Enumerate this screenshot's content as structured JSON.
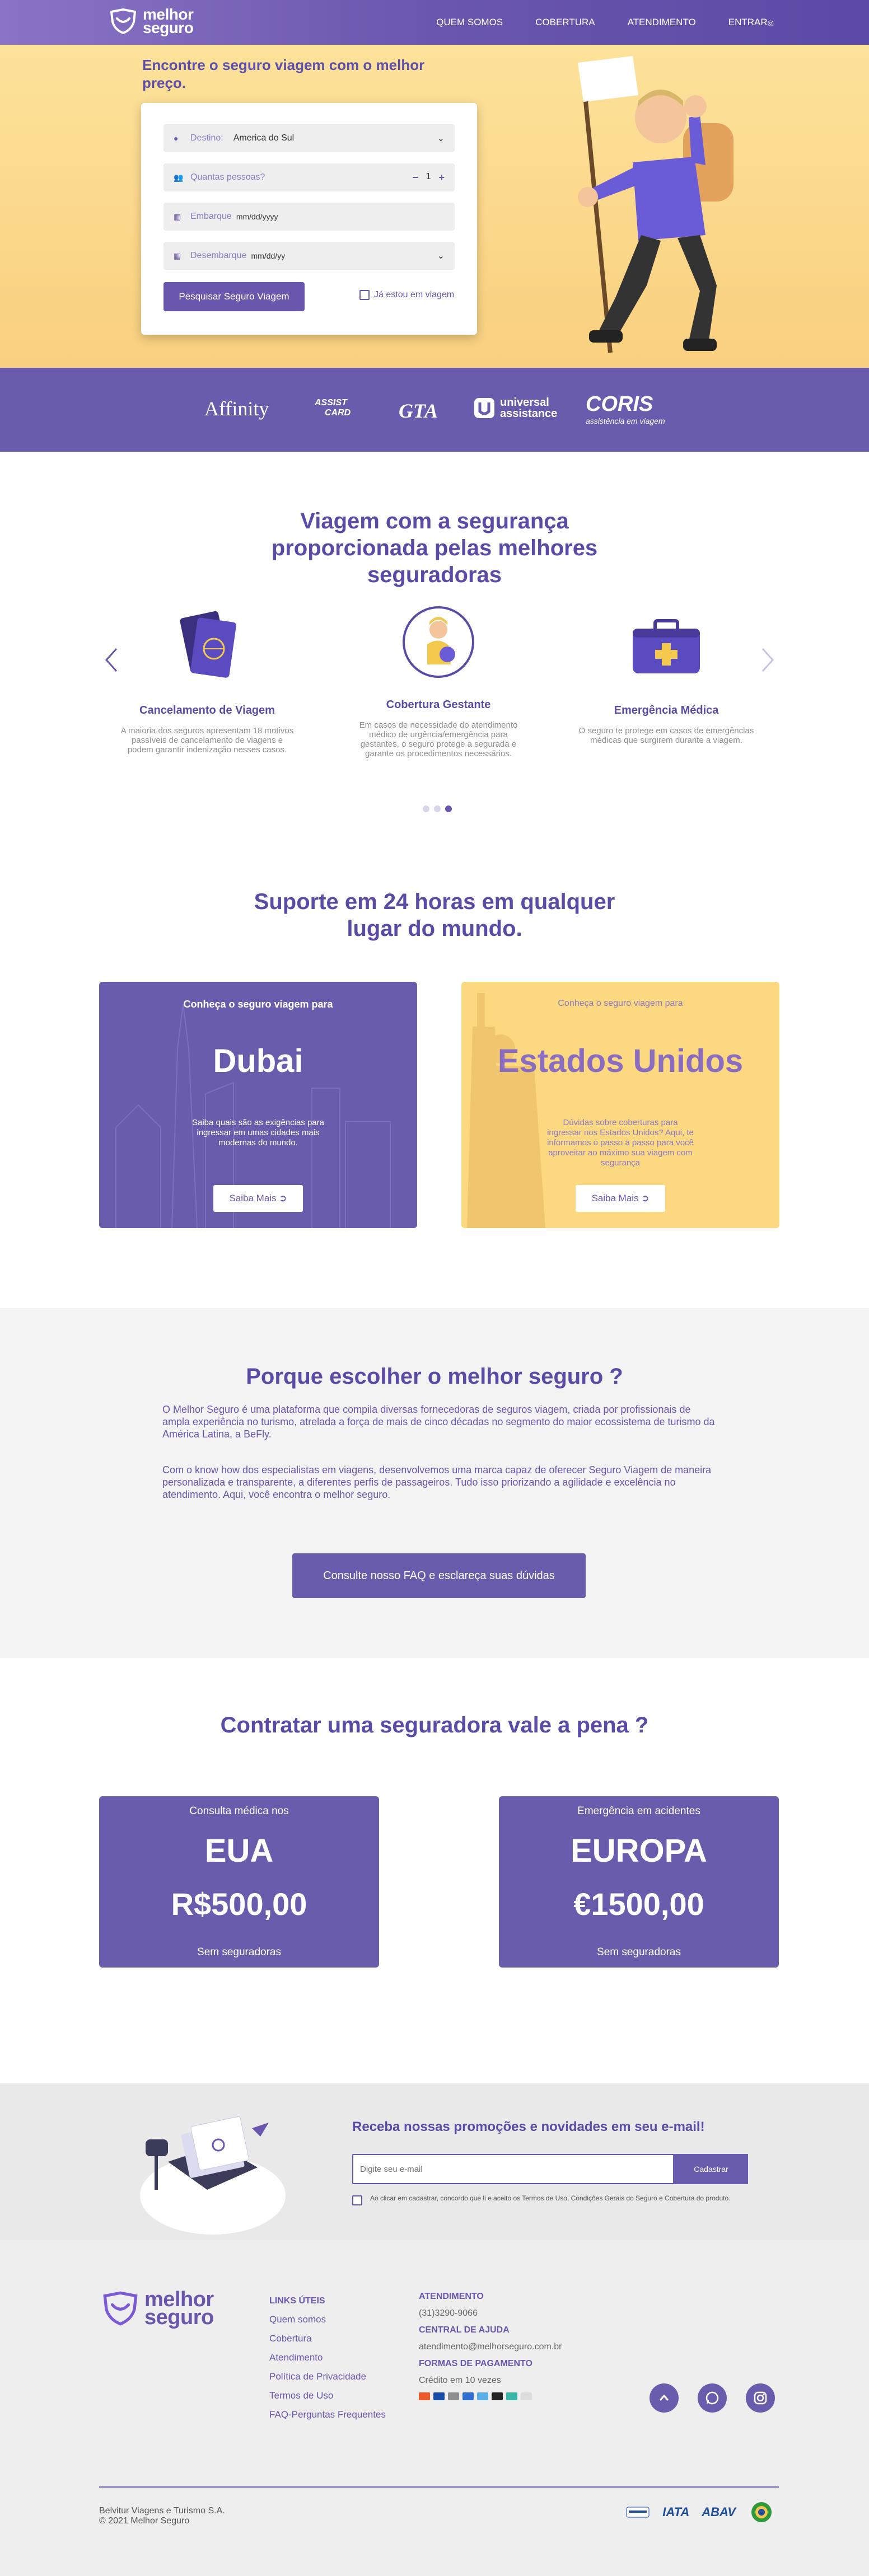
{
  "header": {
    "logo_line1": "melhor",
    "logo_line2": "seguro",
    "nav": [
      "QUEM SOMOS",
      "COBERTURA",
      "ATENDIMENTO",
      "ENTRAR"
    ]
  },
  "hero": {
    "title": "Encontre o seguro viagem com o melhor preço.",
    "destino_label": "Destino:",
    "destino_value": "America do Sul",
    "pessoas_label": "Quantas pessoas?",
    "pessoas_value": "1",
    "embarque_label": "Embarque",
    "embarque_placeholder": "mm/dd/yyyy",
    "desembarque_label": "Desembarque",
    "desembarque_placeholder": "mm/dd/yy",
    "search_button": "Pesquisar Seguro Viagem",
    "already_traveling": "Já estou em viagem"
  },
  "partners": {
    "affinity": "Affinity",
    "assist_card_1": "ASSIST",
    "assist_card_2": "CARD",
    "gta": "GTA",
    "universal_1": "universal",
    "universal_2": "assistance",
    "coris": "CORIS",
    "coris_sub": "assistência em viagem"
  },
  "security": {
    "title": "Viagem com a segurança proporcionada pelas melhores seguradoras",
    "features": [
      {
        "title": "Cancelamento de Viagem",
        "desc": "A maioria dos seguros apresentam 18 motivos passíveis de cancelamento de viagens e podem garantir indenização nesses casos."
      },
      {
        "title": "Cobertura Gestante",
        "desc": "Em casos de necessidade do atendimento médico de urgência/emergência para gestantes, o seguro protege a segurada e garante os procedimentos necessários."
      },
      {
        "title": "Emergência Médica",
        "desc": "O seguro te protege em casos de emergências médicas que surgirem durante a viagem."
      }
    ]
  },
  "support": {
    "title": "Suporte em 24 horas em qualquer lugar do mundo.",
    "dubai": {
      "kicker": "Conheça o seguro viagem para",
      "city": "Dubai",
      "desc": "Saiba quais são as exigências para ingressar em umas cidades mais modernas do mundo.",
      "button": "Saiba Mais"
    },
    "usa": {
      "kicker": "Conheça o seguro viagem para",
      "city": "Estados Unidos",
      "desc": "Dúvidas sobre coberturas para ingressar nos Estados Unidos? Aqui, te informamos o passo a passo para você aproveitar ao máximo sua viagem com segurança",
      "button": "Saiba Mais"
    }
  },
  "why": {
    "title": "Porque escolher o melhor seguro ?",
    "p1": "O Melhor Seguro é uma plataforma que compila diversas fornecedoras de seguros viagem, criada por profissionais de ampla experiência no turismo, atrelada a força de mais de cinco décadas no segmento do maior ecossistema de turismo da América Latina, a BeFly.",
    "p2": "Com o know how dos especialistas em viagens, desenvolvemos uma marca capaz de oferecer Seguro Viagem de maneira personalizada e transparente, a diferentes perfis de passageiros. Tudo isso priorizando a agilidade e excelência no atendimento. Aqui, você encontra o melhor seguro.",
    "faq_button": "Consulte nosso FAQ e esclareça suas dúvidas"
  },
  "worth": {
    "title": "Contratar uma seguradora vale a pena ?",
    "cards": [
      {
        "kicker": "Consulta médica nos",
        "region": "EUA",
        "price": "R$500,00",
        "note": "Sem seguradoras"
      },
      {
        "kicker": "Emergência em acidentes",
        "region": "EUROPA",
        "price": "€1500,00",
        "note": "Sem seguradoras"
      }
    ]
  },
  "newsletter": {
    "title": "Receba nossas promoções e novidades em seu e-mail!",
    "placeholder": "Digite seu e-mail",
    "button": "Cadastrar",
    "consent": "Ao clicar em cadastrar, concordo que li e aceito os Termos de Uso, Condições Gerais do Seguro e Cobertura do produto."
  },
  "footer": {
    "links_title": "LINKS ÚTEIS",
    "links": [
      "Quem somos",
      "Cobertura",
      "Atendimento",
      "Política de Privacidade",
      "Termos de Uso",
      "FAQ-Perguntas Frequentes"
    ],
    "atendimento_title": "ATENDIMENTO",
    "phone": "(31)3290-9066",
    "central_title": "CENTRAL DE AJUDA",
    "email": "atendimento@melhorseguro.com.br",
    "payment_title": "FORMAS DE PAGAMENTO",
    "payment_value": "Crédito em 10 vezes",
    "company": "Belvitur Viagens e Turismo S.A.",
    "copyright": "© 2021 Melhor Seguro",
    "badges": {
      "iata": "IATA",
      "abav": "ABAV"
    }
  },
  "colors": {
    "brand": "#6a56ad",
    "yellow": "#fcd881"
  }
}
